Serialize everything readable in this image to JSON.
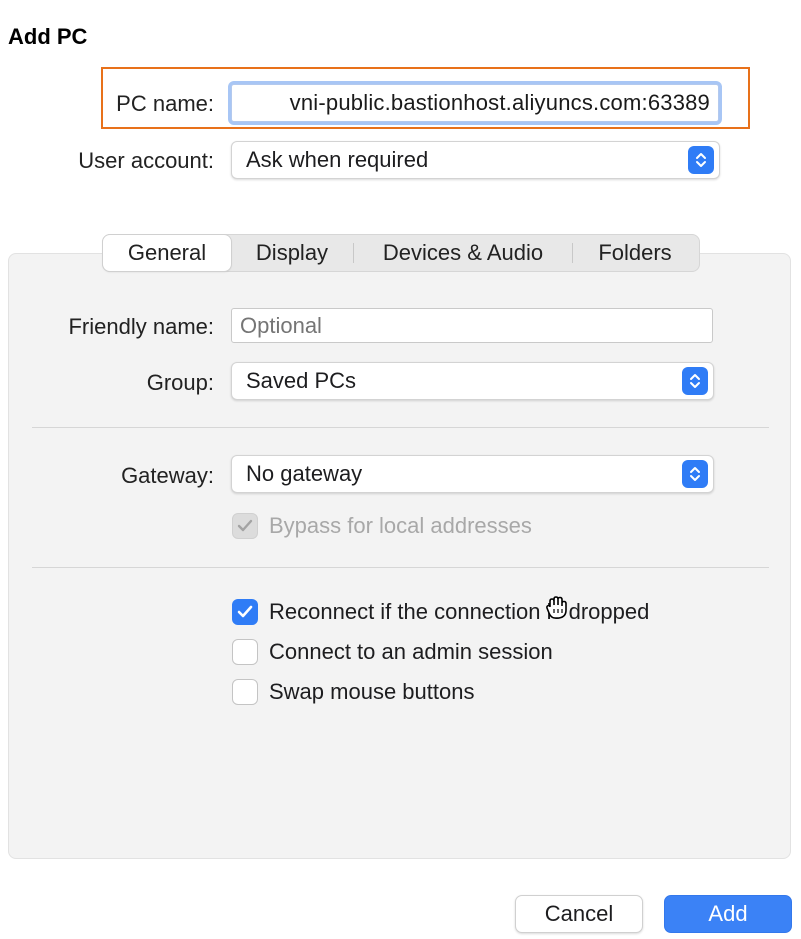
{
  "dialog": {
    "title": "Add PC"
  },
  "connection": {
    "pc_name_label": "PC name:",
    "pc_name_value": "vni-public.bastionhost.aliyuncs.com:63389",
    "user_account_label": "User account:",
    "user_account_value": "Ask when required"
  },
  "tabs": [
    {
      "label": "General",
      "active": true
    },
    {
      "label": "Display",
      "active": false
    },
    {
      "label": "Devices & Audio",
      "active": false
    },
    {
      "label": "Folders",
      "active": false
    }
  ],
  "general": {
    "friendly_name_label": "Friendly name:",
    "friendly_name_placeholder": "Optional",
    "group_label": "Group:",
    "group_value": "Saved PCs",
    "gateway_label": "Gateway:",
    "gateway_value": "No gateway",
    "bypass_label": "Bypass for local addresses",
    "bypass_checked": true,
    "options": [
      {
        "label": "Reconnect if the connection is dropped",
        "checked": true
      },
      {
        "label": "Connect to an admin session",
        "checked": false
      },
      {
        "label": "Swap mouse buttons",
        "checked": false
      }
    ]
  },
  "footer": {
    "cancel_label": "Cancel",
    "add_label": "Add"
  },
  "colors": {
    "accent": "#2f7cf6",
    "highlight": "#e8711a",
    "primary_button": "#3b82f6"
  }
}
